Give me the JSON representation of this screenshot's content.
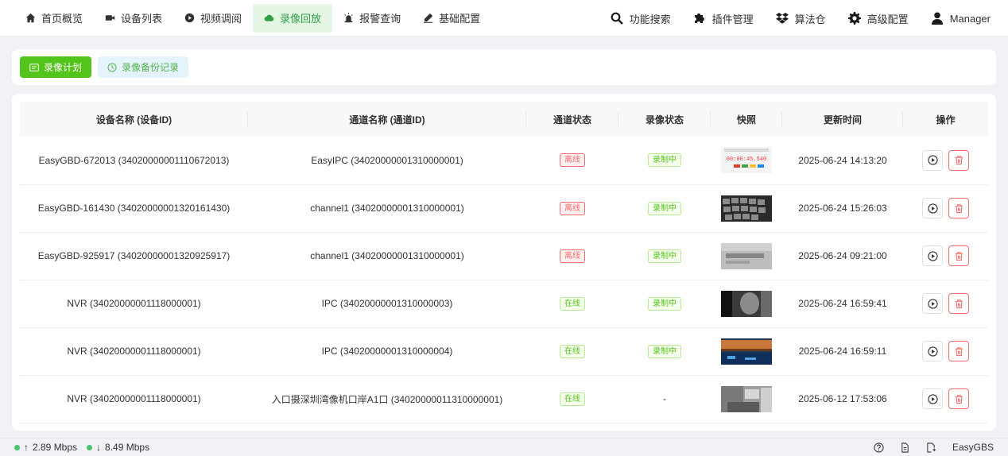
{
  "nav": {
    "items": [
      {
        "label": "首页概览",
        "icon": "home-icon"
      },
      {
        "label": "设备列表",
        "icon": "video-camera-icon"
      },
      {
        "label": "视频调阅",
        "icon": "play-circle-icon"
      },
      {
        "label": "录像回放",
        "icon": "cloud-icon"
      },
      {
        "label": "报警查询",
        "icon": "alarm-icon"
      },
      {
        "label": "基础配置",
        "icon": "pen-icon"
      }
    ],
    "right": [
      {
        "label": "功能搜索",
        "icon": "search-icon"
      },
      {
        "label": "插件管理",
        "icon": "puzzle-icon"
      },
      {
        "label": "算法仓",
        "icon": "dropbox-icon"
      },
      {
        "label": "高级配置",
        "icon": "gear-icon"
      },
      {
        "label": "Manager",
        "icon": "user-icon"
      }
    ]
  },
  "toolbar": {
    "plan_label": "录像计划",
    "backup_label": "录像备份记录"
  },
  "table": {
    "headers": [
      "设备名称 (设备ID)",
      "通道名称 (通道ID)",
      "通道状态",
      "录像状态",
      "快照",
      "更新时间",
      "操作"
    ],
    "rows": [
      {
        "device": "EasyGBD-672013 (34020000001110672013)",
        "channel": "EasyIPC (34020000001310000001)",
        "channel_status": "离线",
        "record_status": "录制中",
        "time": "2025-06-24 14:13:20",
        "snapshot_text": "00:00:45.540"
      },
      {
        "device": "EasyGBD-161430 (34020000001320161430)",
        "channel": "channel1 (34020000001310000001)",
        "channel_status": "离线",
        "record_status": "录制中",
        "time": "2025-06-24 15:26:03"
      },
      {
        "device": "EasyGBD-925917 (34020000001320925917)",
        "channel": "channel1 (34020000001310000001)",
        "channel_status": "离线",
        "record_status": "录制中",
        "time": "2025-06-24 09:21:00"
      },
      {
        "device": "NVR (34020000001118000001)",
        "channel": "IPC (34020000001310000003)",
        "channel_status": "在线",
        "record_status": "录制中",
        "time": "2025-06-24 16:59:41"
      },
      {
        "device": "NVR (34020000001118000001)",
        "channel": "IPC (34020000001310000004)",
        "channel_status": "在线",
        "record_status": "录制中",
        "time": "2025-06-24 16:59:11"
      },
      {
        "device": "NVR (34020000001118000001)",
        "channel": "入口摄深圳湾像机口岸A1口 (34020000011310000001)",
        "channel_status": "在线",
        "record_status": "-",
        "time": "2025-06-12 17:53:06"
      }
    ]
  },
  "status": {
    "upload": "2.89 Mbps",
    "download": "8.49 Mbps",
    "brand": "EasyGBS"
  },
  "colors": {
    "accent": "#52c41a",
    "offline": "#f56c6c",
    "online": "#52c41a"
  }
}
